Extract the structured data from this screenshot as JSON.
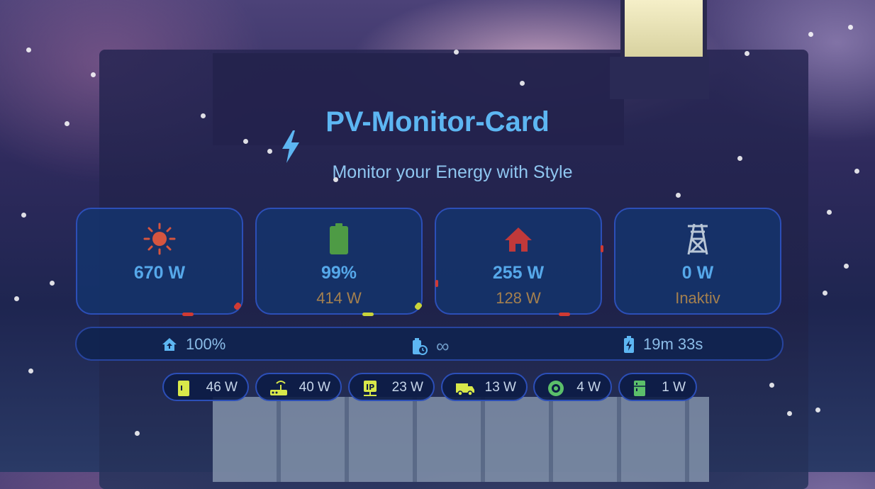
{
  "header": {
    "title": "PV-Monitor-Card",
    "subtitle": "Monitor your Energy with Style"
  },
  "cards": [
    {
      "name": "pv",
      "icon": "sun-icon",
      "value": "670 W",
      "sub": ""
    },
    {
      "name": "battery",
      "icon": "battery-icon",
      "value": "99%",
      "sub": "414 W"
    },
    {
      "name": "house",
      "icon": "home-icon",
      "value": "255 W",
      "sub": "128 W"
    },
    {
      "name": "grid",
      "icon": "transmission-tower-icon",
      "value": "0 W",
      "sub": "Inaktiv"
    }
  ],
  "status": {
    "autarky": "100%",
    "remaining": "∞",
    "charge_time": "19m 33s"
  },
  "consumers": [
    {
      "icon": "appliance-icon",
      "value": "46 W"
    },
    {
      "icon": "router-icon",
      "value": "40 W"
    },
    {
      "icon": "ip-device-icon",
      "value": "23 W"
    },
    {
      "icon": "van-icon",
      "value": "13 W"
    },
    {
      "icon": "robot-vacuum-icon",
      "value": "4 W"
    },
    {
      "icon": "fridge-icon",
      "value": "1 W"
    }
  ],
  "colors": {
    "accent": "#5db6f2",
    "sun": "#d6553f",
    "battery": "#4e9b45",
    "house": "#c0393a",
    "grid": "#b9c6d6",
    "sub_text": "#a5804e",
    "chip_icon": "#d8e84a"
  }
}
